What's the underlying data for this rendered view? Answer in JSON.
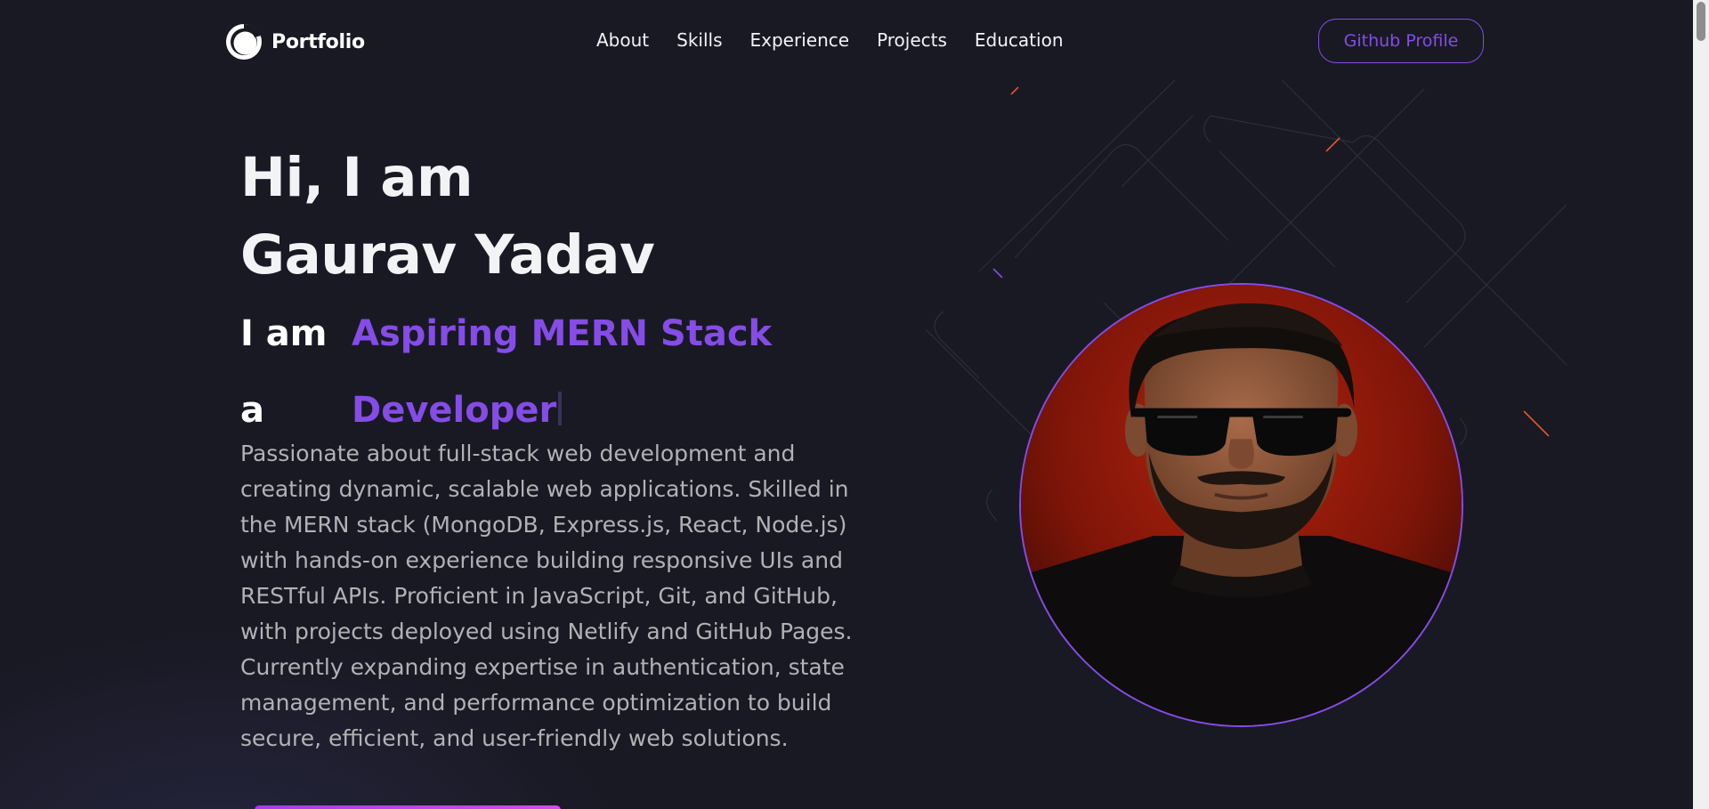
{
  "nav": {
    "logo_text": "Portfolio",
    "links": [
      "About",
      "Skills",
      "Experience",
      "Projects",
      "Education"
    ],
    "github_button": "Github Profile"
  },
  "hero": {
    "greeting_line1": "Hi, I am",
    "greeting_line2": "Gaurav Yadav",
    "typing_prefix": "I am a",
    "typing_text": "Aspiring MERN Stack Developer",
    "description": "Passionate about full-stack web development and creating dynamic, scalable web applications. Skilled in the MERN stack (MongoDB, Express.js, React, Node.js) with hands-on experience building responsive UIs and RESTful APIs. Proficient in JavaScript, Git, and GitHub, with projects deployed using Netlify and GitHub Pages. Currently expanding expertise in authentication, state management, and performance optimization to build secure, efficient, and user-friendly web solutions."
  },
  "colors": {
    "background": "#191924",
    "primary": "#854ce6",
    "text_primary": "#f2f3f5",
    "text_secondary": "#b1b2b3"
  },
  "icons": {
    "logo": "portfolio-logo-icon"
  }
}
